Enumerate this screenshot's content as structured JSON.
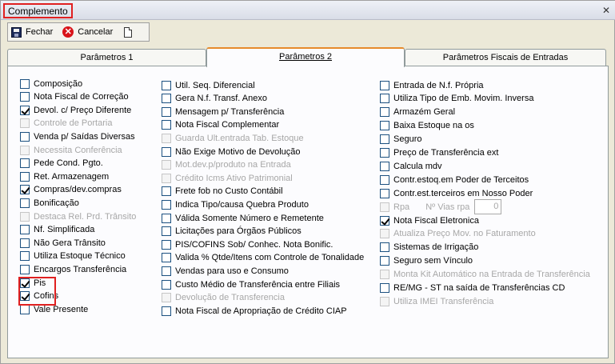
{
  "window": {
    "title": "Complemento",
    "close_glyph": "✕"
  },
  "toolbar": {
    "save_label": "Fechar",
    "cancel_label": "Cancelar",
    "save_icon": "save-disk-icon",
    "cancel_icon": "cancel-x-icon",
    "new_icon": "new-document-icon"
  },
  "tabs": [
    {
      "label": "Parâmetros 1",
      "active": false
    },
    {
      "label": "Parâmetros 2",
      "active": true
    },
    {
      "label": "Parâmetros Fiscais de Entradas",
      "active": false
    }
  ],
  "col1": [
    {
      "label": "Composição",
      "checked": false,
      "enabled": true
    },
    {
      "label": "Nota Fiscal de Correção",
      "checked": false,
      "enabled": true
    },
    {
      "label": "Devol. c/ Preço Diferente",
      "checked": true,
      "enabled": true
    },
    {
      "label": "Controle de Portaria",
      "checked": false,
      "enabled": false
    },
    {
      "label": "Venda p/ Saídas Diversas",
      "checked": false,
      "enabled": true
    },
    {
      "label": "Necessita Conferência",
      "checked": false,
      "enabled": false
    },
    {
      "label": "Pede Cond. Pgto.",
      "checked": false,
      "enabled": true
    },
    {
      "label": "Ret. Armazenagem",
      "checked": false,
      "enabled": true
    },
    {
      "label": "Compras/dev.compras",
      "checked": true,
      "enabled": true
    },
    {
      "label": "Bonificação",
      "checked": false,
      "enabled": true
    },
    {
      "label": "Destaca Rel. Prd. Trânsito",
      "checked": false,
      "enabled": false
    },
    {
      "label": "Nf. Simplificada",
      "checked": false,
      "enabled": true
    },
    {
      "label": "Não Gera Trânsito",
      "checked": false,
      "enabled": true
    },
    {
      "label": "Utiliza Estoque Técnico",
      "checked": false,
      "enabled": true
    },
    {
      "label": "Encargos Transferência",
      "checked": false,
      "enabled": true
    },
    {
      "label": "Pis",
      "checked": true,
      "enabled": true
    },
    {
      "label": "Cofins",
      "checked": true,
      "enabled": true
    },
    {
      "label": "Vale Presente",
      "checked": false,
      "enabled": true
    }
  ],
  "col2": [
    {
      "label": "Util. Seq. Diferencial",
      "checked": false,
      "enabled": true
    },
    {
      "label": "Gera N.f. Transf. Anexo",
      "checked": false,
      "enabled": true
    },
    {
      "label": "Mensagem p/ Transferência",
      "checked": false,
      "enabled": true
    },
    {
      "label": "Nota Fiscal Complementar",
      "checked": false,
      "enabled": true
    },
    {
      "label": "Guarda Ult.entrada Tab. Estoque",
      "checked": false,
      "enabled": false
    },
    {
      "label": "Não Exige Motivo de Devolução",
      "checked": false,
      "enabled": true
    },
    {
      "label": "Mot.dev.p/produto na Entrada",
      "checked": false,
      "enabled": false
    },
    {
      "label": "Crédito Icms Ativo Patrimonial",
      "checked": false,
      "enabled": false
    },
    {
      "label": "Frete fob no Custo Contábil",
      "checked": false,
      "enabled": true
    },
    {
      "label": "Indica Tipo/causa Quebra Produto",
      "checked": false,
      "enabled": true
    },
    {
      "label": "Válida Somente Número e Remetente",
      "checked": false,
      "enabled": true
    },
    {
      "label": "Licitações para Órgãos Públicos",
      "checked": false,
      "enabled": true
    },
    {
      "label": "PIS/COFINS Sob/ Conhec. Nota Bonific.",
      "checked": false,
      "enabled": true
    },
    {
      "label": "Valida % Qtde/Itens com Controle de Tonalidade",
      "checked": false,
      "enabled": true
    },
    {
      "label": "Vendas para uso e Consumo",
      "checked": false,
      "enabled": true
    },
    {
      "label": "Custo Médio de Transferência entre Filiais",
      "checked": false,
      "enabled": true
    },
    {
      "label": "Devolução de Transferencia",
      "checked": false,
      "enabled": false
    },
    {
      "label": "Nota Fiscal de Apropriação de Crédito CIAP",
      "checked": false,
      "enabled": true
    }
  ],
  "col3": [
    {
      "label": "Entrada de N.f. Própria",
      "checked": false,
      "enabled": true
    },
    {
      "label": "Utiliza Tipo de Emb. Movim. Inversa",
      "checked": false,
      "enabled": true
    },
    {
      "label": "Armazém Geral",
      "checked": false,
      "enabled": true
    },
    {
      "label": "Baixa Estoque na os",
      "checked": false,
      "enabled": true
    },
    {
      "label": "Seguro",
      "checked": false,
      "enabled": true
    },
    {
      "label": "Preço de Transferência ext",
      "checked": false,
      "enabled": true
    },
    {
      "label": "Calcula mdv",
      "checked": false,
      "enabled": true
    },
    {
      "label": "Contr.estoq.em Poder de Terceitos",
      "checked": false,
      "enabled": true
    },
    {
      "label": "Contr.est.terceiros em Nosso Poder",
      "checked": false,
      "enabled": true
    },
    {
      "label": "Rpa",
      "checked": false,
      "enabled": false
    },
    {
      "label": "Nota Fiscal Eletronica",
      "checked": true,
      "enabled": true
    },
    {
      "label": "Atualiza Preço Mov. no Faturamento",
      "checked": false,
      "enabled": false
    },
    {
      "label": "Sistemas de Irrigação",
      "checked": false,
      "enabled": true
    },
    {
      "label": "Seguro sem Vínculo",
      "checked": false,
      "enabled": true
    },
    {
      "label": "Monta Kit Automático na Entrada de Transferência",
      "checked": false,
      "enabled": false
    },
    {
      "label": "RE/MG - ST na saída de Transferências CD",
      "checked": false,
      "enabled": true
    },
    {
      "label": "Utiliza IMEI Transferência",
      "checked": false,
      "enabled": false
    }
  ],
  "rpa": {
    "vias_label": "Nº Vias rpa",
    "vias_value": "0"
  }
}
